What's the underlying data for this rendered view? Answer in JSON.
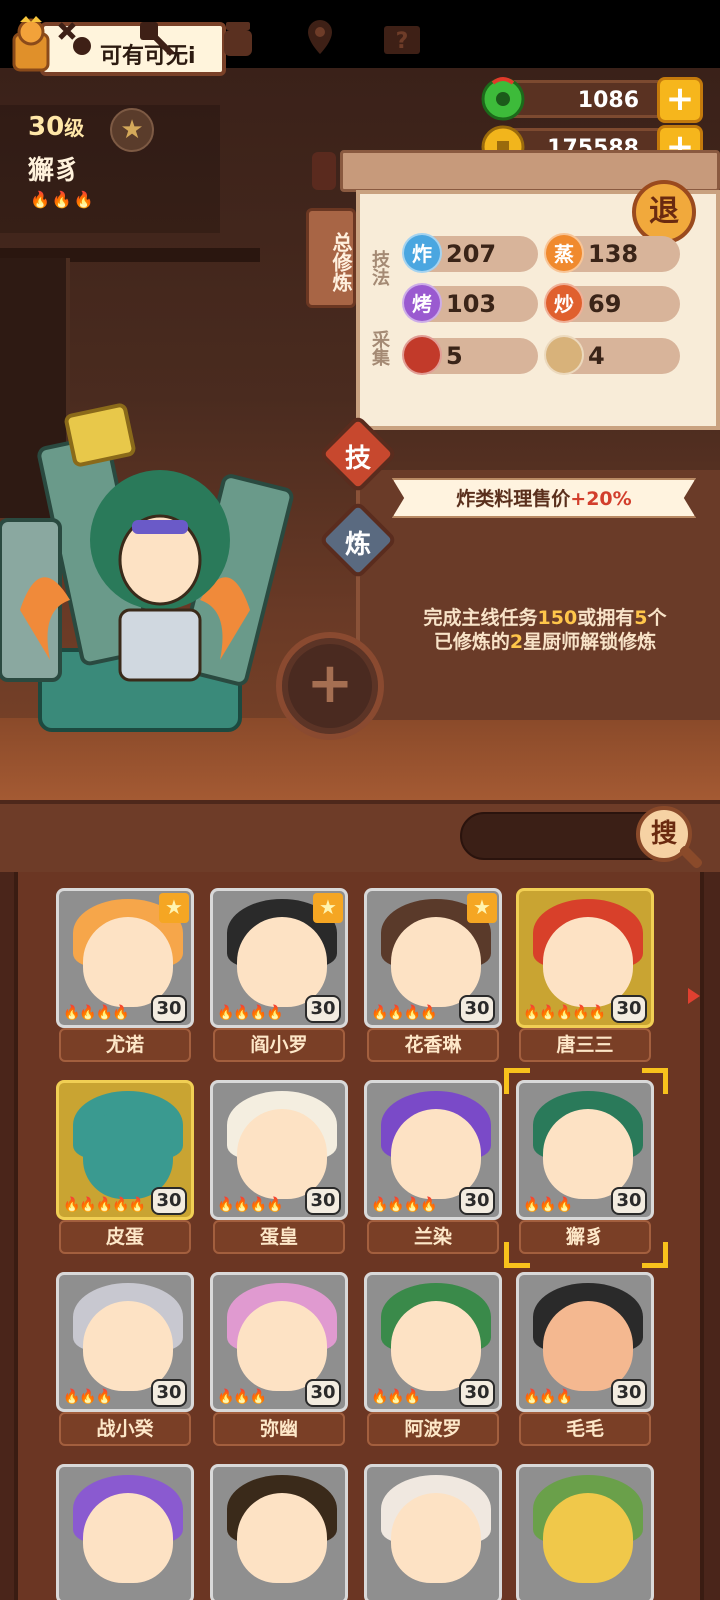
{
  "player": {
    "name": "可有可无i"
  },
  "currencies": [
    {
      "name": "jade",
      "value": "1086",
      "icon": "green-jade-icon",
      "color": "#3dbb3a"
    },
    {
      "name": "coins",
      "value": "175588",
      "icon": "gold-coin-icon",
      "color": "#f2b51c"
    }
  ],
  "chef": {
    "level_number": "30",
    "level_unit": "级",
    "title": "獬豸",
    "flames": "🔥🔥🔥"
  },
  "panel": {
    "tab_label": "总修炼",
    "exit_label": "退",
    "skills_label": "技法",
    "gather_label": "采集",
    "skills": [
      {
        "badge": "炸",
        "value": "207",
        "color": "#4aa6e0"
      },
      {
        "badge": "蒸",
        "value": "138",
        "color": "#f08a2e"
      },
      {
        "badge": "烤",
        "value": "103",
        "color": "#9a5ad0"
      },
      {
        "badge": "炒",
        "value": "69",
        "color": "#e0602e"
      }
    ],
    "gather": [
      {
        "icon": "meat-icon",
        "value": "5",
        "color": "#c23a2a"
      },
      {
        "icon": "flour-icon",
        "value": "4",
        "color": "#d8b27a"
      }
    ]
  },
  "modes": [
    {
      "label": "技",
      "color": "#c7482e"
    },
    {
      "label": "炼",
      "color": "#5a6a80"
    }
  ],
  "bonus": {
    "prefix": "炸类料理售价",
    "value": "+20%"
  },
  "unlock": {
    "line1_a": "完成主线任务",
    "line1_num": "150",
    "line1_b": "或拥有",
    "line1_num2": "5",
    "line1_c": "个",
    "line2_a": "已修炼的",
    "line2_num": "2",
    "line2_b": "星厨师解锁修炼"
  },
  "add_label": "+",
  "search": {
    "button_label": "搜",
    "placeholder": ""
  },
  "filters": [
    "fork-spoon-icon",
    "spatula-icon",
    "jar-icon",
    "location-icon",
    "help-book-icon"
  ],
  "chefs": [
    {
      "name": "尤诺",
      "level": "30",
      "flames": "🔥🔥🔥🔥",
      "star": true,
      "gold": false,
      "hair": "#f6a64a",
      "skin": "#fde2c4"
    },
    {
      "name": "阎小罗",
      "level": "30",
      "flames": "🔥🔥🔥🔥",
      "star": true,
      "gold": false,
      "hair": "#2a2a2a",
      "skin": "#fde2c4"
    },
    {
      "name": "花香琳",
      "level": "30",
      "flames": "🔥🔥🔥🔥",
      "star": true,
      "gold": false,
      "hair": "#5a3a2a",
      "skin": "#fde2c4"
    },
    {
      "name": "唐三三",
      "level": "30",
      "flames": "🔥🔥🔥🔥🔥",
      "star": false,
      "gold": true,
      "hair": "#d8402a",
      "skin": "#fde2c4"
    },
    {
      "name": "皮蛋",
      "level": "30",
      "flames": "🔥🔥🔥🔥🔥",
      "star": false,
      "gold": true,
      "hair": "#3a9a90",
      "skin": "#3a9a90"
    },
    {
      "name": "蛋皇",
      "level": "30",
      "flames": "🔥🔥🔥🔥",
      "star": false,
      "gold": false,
      "hair": "#f4eee0",
      "skin": "#fde2c4"
    },
    {
      "name": "兰染",
      "level": "30",
      "flames": "🔥🔥🔥🔥",
      "star": false,
      "gold": false,
      "hair": "#7a4ac8",
      "skin": "#fde2c4"
    },
    {
      "name": "獬豸",
      "level": "30",
      "flames": "🔥🔥🔥",
      "star": false,
      "gold": false,
      "hair": "#2a7a5a",
      "skin": "#fde2c4",
      "selected": true
    },
    {
      "name": "战小癸",
      "level": "30",
      "flames": "🔥🔥🔥",
      "star": false,
      "gold": false,
      "hair": "#c8c8d0",
      "skin": "#fde2c4"
    },
    {
      "name": "弥幽",
      "level": "30",
      "flames": "🔥🔥🔥",
      "star": false,
      "gold": false,
      "hair": "#e09ad0",
      "skin": "#fde2c4"
    },
    {
      "name": "阿波罗",
      "level": "30",
      "flames": "🔥🔥🔥",
      "star": false,
      "gold": false,
      "hair": "#3a8a4a",
      "skin": "#fde2c4"
    },
    {
      "name": "毛毛",
      "level": "30",
      "flames": "🔥🔥🔥",
      "star": false,
      "gold": false,
      "hair": "#2a2a2a",
      "skin": "#f4b890"
    },
    {
      "name": "",
      "level": "",
      "flames": "",
      "star": false,
      "gold": false,
      "hair": "#8a5ad0",
      "skin": "#fde2c4"
    },
    {
      "name": "",
      "level": "",
      "flames": "",
      "star": false,
      "gold": false,
      "hair": "#3a2a1a",
      "skin": "#fde2c4"
    },
    {
      "name": "",
      "level": "",
      "flames": "",
      "star": false,
      "gold": false,
      "hair": "#f0e8e0",
      "skin": "#fde2c4"
    },
    {
      "name": "",
      "level": "",
      "flames": "",
      "star": false,
      "gold": false,
      "hair": "#6aa04a",
      "skin": "#f0c84a"
    }
  ]
}
